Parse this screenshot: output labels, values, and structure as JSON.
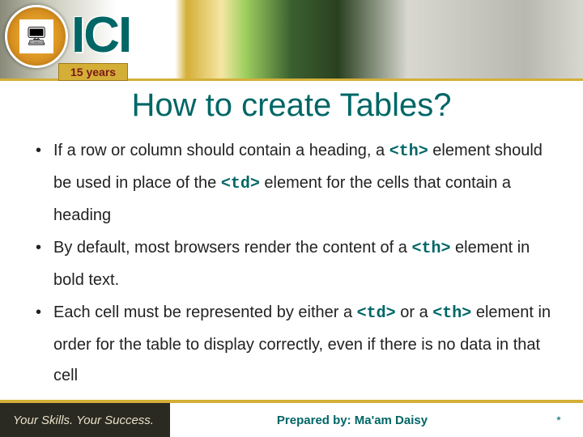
{
  "header": {
    "logo": "ICI",
    "anniversary": "15  years",
    "seal_glyph": "🖥"
  },
  "title": "How to create Tables?",
  "bullets": [
    {
      "pre": "If a row or column should contain a heading, a ",
      "c1": "<th>",
      "mid": " element should be used in place of the ",
      "c2": "<td>",
      "post": "  element for the cells that contain a heading"
    },
    {
      "pre": "By default, most browsers render the content of a ",
      "c1": "<th>",
      "mid": " element in bold text.",
      "c2": "",
      "post": ""
    },
    {
      "pre": "Each cell must be represented by either a ",
      "c1": "<td>",
      "mid": "  or a ",
      "c2": "<th>",
      "post": "  element in order for the table to display correctly, even if there is no data in that cell"
    }
  ],
  "footer": {
    "tagline": "Your Skills. Your Success.",
    "prepared": "Prepared by: Ma'am Daisy",
    "marker": "*"
  }
}
